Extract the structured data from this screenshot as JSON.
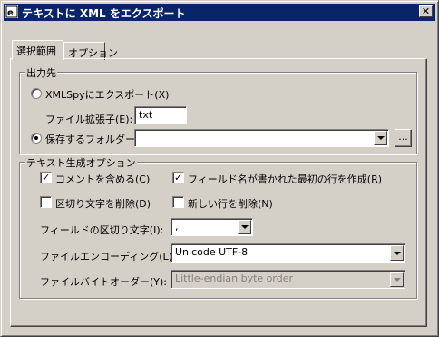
{
  "window": {
    "title": "テキストに XML をエクスポート",
    "close_glyph": "✕",
    "titlebar_color": "#0a246a",
    "app_icon": "xmlspy-app-icon"
  },
  "tabs": [
    {
      "label": "選択範囲",
      "active": true
    },
    {
      "label": "オプション",
      "active": false
    }
  ],
  "output": {
    "legend": "出力先",
    "radio_xmlspy": {
      "label": "XMLSpyにエクスポート(X)",
      "selected": false
    },
    "extension_label": "ファイル拡張子(E):",
    "extension_value": "txt",
    "radio_folder": {
      "label": "保存するフォルダー(F)",
      "selected": true
    },
    "folder_value": "",
    "browse_label": "..."
  },
  "text_options": {
    "legend": "テキスト生成オプション",
    "include_comments": {
      "label": "コメントを含める(C)",
      "checked": true
    },
    "field_names_first_row": {
      "label": "フィールド名が書かれた最初の行を作成(R)",
      "checked": true
    },
    "remove_delimiters": {
      "label": "区切り文字を削除(D)",
      "checked": false
    },
    "remove_newlines": {
      "label": "新しい行を削除(N)",
      "checked": false
    },
    "field_delimiter_label": "フィールドの区切り文字(I):",
    "field_delimiter_value": ",",
    "encoding_label": "ファイルエンコーディング(L):",
    "encoding_value": "Unicode UTF-8",
    "byte_order_label": "ファイルバイトオーダー(Y):",
    "byte_order_value": "Little-endian byte order"
  }
}
